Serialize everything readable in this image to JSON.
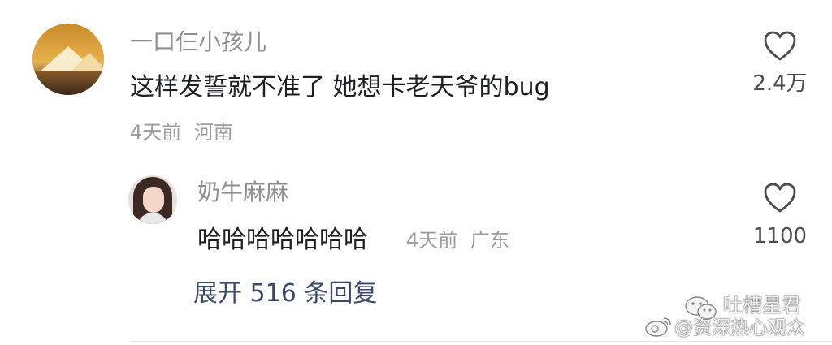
{
  "comment": {
    "username": "一口仨小孩儿",
    "text": "这样发誓就不准了 她想卡老天爷的bug",
    "time": "4天前",
    "location": "河南",
    "like_count": "2.4万",
    "avatar_icon": "mountain-avatar"
  },
  "reply": {
    "username": "奶牛麻麻",
    "text": "哈哈哈哈哈哈哈",
    "time": "4天前",
    "location": "广东",
    "like_count": "1100",
    "avatar_icon": "portrait-avatar"
  },
  "expand_replies_label": "展开 516 条回复",
  "watermark": {
    "line1": "吐槽星君",
    "line2": "@资深热心观众"
  },
  "colors": {
    "username": "#8d8f95",
    "text": "#1d1f24",
    "meta": "#9a9ca2",
    "link": "#3c4a66"
  }
}
